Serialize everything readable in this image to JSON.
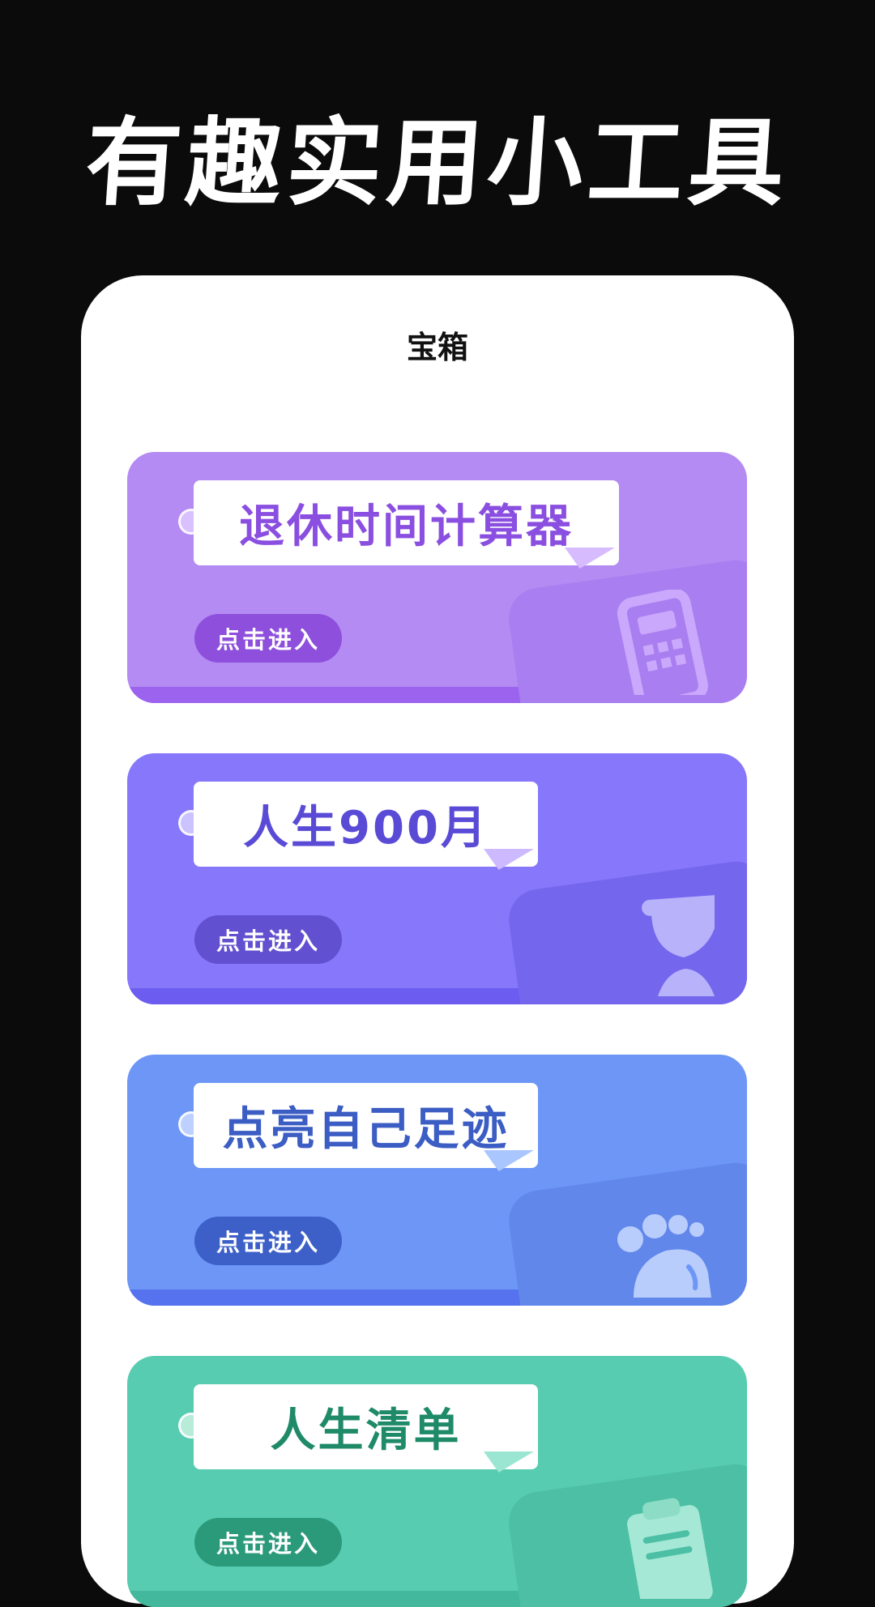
{
  "headline": "有趣实用小工具",
  "screen": {
    "title": "宝箱"
  },
  "cards": [
    {
      "title": "退休时间计算器",
      "button_label": "点击进入",
      "icon": "calculator-icon",
      "color": "#b48af3"
    },
    {
      "title": "人生900月",
      "button_label": "点击进入",
      "icon": "hourglass-icon",
      "color": "#8677fb"
    },
    {
      "title": "点亮自己足迹",
      "button_label": "点击进入",
      "icon": "footprint-icon",
      "color": "#6d96f6"
    },
    {
      "title": "人生清单",
      "button_label": "点击进入",
      "icon": "clipboard-icon",
      "color": "#57ccb1"
    }
  ]
}
